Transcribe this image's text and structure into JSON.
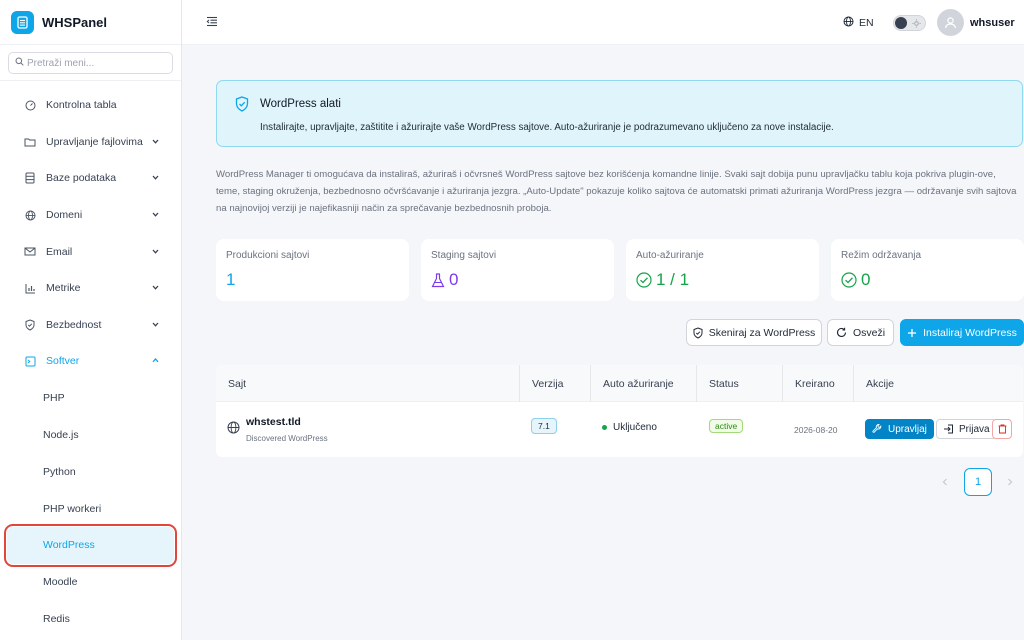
{
  "brand": {
    "name": "WHSPanel"
  },
  "search": {
    "placeholder": "Pretraži meni..."
  },
  "sidebar": {
    "items": [
      {
        "label": "Kontrolna tabla"
      },
      {
        "label": "Upravljanje fajlovima"
      },
      {
        "label": "Baze podataka"
      },
      {
        "label": "Domeni"
      },
      {
        "label": "Email"
      },
      {
        "label": "Metrike"
      },
      {
        "label": "Bezbednost"
      },
      {
        "label": "Softver"
      }
    ],
    "subitems": [
      {
        "label": "PHP"
      },
      {
        "label": "Node.js"
      },
      {
        "label": "Python"
      },
      {
        "label": "PHP workeri"
      },
      {
        "label": "WordPress"
      },
      {
        "label": "Moodle"
      },
      {
        "label": "Redis"
      }
    ]
  },
  "topbar": {
    "language": "EN",
    "username": "whsuser"
  },
  "alert": {
    "title": "WordPress alati",
    "text": "Instalirajte, upravljajte, zaštitite i ažurirajte vaše WordPress sajtove. Auto-ažuriranje je podrazumevano uključeno za nove instalacije."
  },
  "description": "WordPress Manager ti omogućava da instaliraš, ažuriraš i očvrsneš WordPress sajtove bez korišćenja komandne linije. Svaki sajt dobija punu upravljačku tablu koja pokriva plugin-ove, teme, staging okruženja, bezbednosno očvršćavanje i ažuriranja jezgra. „Auto-Update\" pokazuje koliko sajtova će automatski primati ažuriranja WordPress jezgra — održavanje svih sajtova na najnovijoj verziji je najefikasniji način za sprečavanje bezbednosnih proboja.",
  "cards": [
    {
      "title": "Produkcioni sajtovi",
      "value": "1"
    },
    {
      "title": "Staging sajtovi",
      "value": "0"
    },
    {
      "title": "Auto-ažuriranje",
      "value": "1 / 1"
    },
    {
      "title": "Režim održavanja",
      "value": "0"
    }
  ],
  "actions": {
    "scan": "Skeniraj za WordPress",
    "refresh": "Osveži",
    "install": "Instaliraj WordPress"
  },
  "table": {
    "headers": [
      "Sajt",
      "Verzija",
      "Auto ažuriranje",
      "Status",
      "Kreirano",
      "Akcije"
    ],
    "rows": [
      {
        "site": "whstest.tld",
        "sub": "Discovered WordPress",
        "version": "7.1",
        "auto_update": "Uključeno",
        "status": "active",
        "created": "2026-08-20",
        "manage": "Upravljaj",
        "login": "Prijava"
      }
    ]
  },
  "pagination": {
    "current": "1"
  },
  "colors": {
    "accent": "#0ea5e9",
    "success": "#16a34a",
    "staging": "#7c3aed",
    "danger": "#dc2626"
  }
}
